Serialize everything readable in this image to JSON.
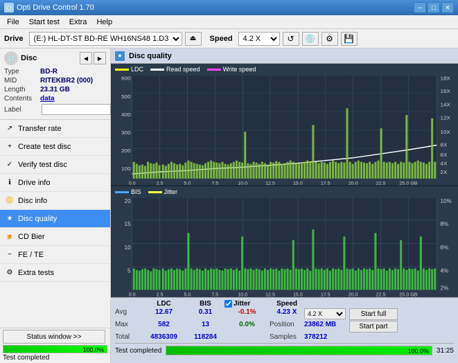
{
  "app": {
    "title": "Opti Drive Control 1.70",
    "icon": "💿"
  },
  "titlebar": {
    "minimize": "─",
    "maximize": "□",
    "close": "✕"
  },
  "menu": {
    "items": [
      "File",
      "Start test",
      "Extra",
      "Help"
    ]
  },
  "drive_bar": {
    "label": "Drive",
    "drive_value": "(E:) HL-DT-ST BD-RE  WH16NS48 1.D3",
    "speed_label": "Speed",
    "speed_value": "4.2 X"
  },
  "disc": {
    "title": "Disc",
    "type_label": "Type",
    "type_value": "BD-R",
    "mid_label": "MID",
    "mid_value": "RITEKBR2 (000)",
    "length_label": "Length",
    "length_value": "23.31 GB",
    "contents_label": "Contents",
    "contents_value": "data",
    "label_label": "Label",
    "label_placeholder": ""
  },
  "nav": {
    "items": [
      {
        "id": "transfer-rate",
        "label": "Transfer rate",
        "icon": "↗"
      },
      {
        "id": "create-test-disc",
        "label": "Create test disc",
        "icon": "+"
      },
      {
        "id": "verify-test-disc",
        "label": "Verify test disc",
        "icon": "✓"
      },
      {
        "id": "drive-info",
        "label": "Drive info",
        "icon": "ℹ"
      },
      {
        "id": "disc-info",
        "label": "Disc info",
        "icon": "📀"
      },
      {
        "id": "disc-quality",
        "label": "Disc quality",
        "icon": "★",
        "active": true
      },
      {
        "id": "cd-bier",
        "label": "CD Bier",
        "icon": "🍺"
      },
      {
        "id": "fe-te",
        "label": "FE / TE",
        "icon": "~"
      },
      {
        "id": "extra-tests",
        "label": "Extra tests",
        "icon": "⚙"
      }
    ]
  },
  "status_bar": {
    "button_label": "Status window >>",
    "progress_percent": "100.0%",
    "progress_value": 100,
    "status_text": "Test completed"
  },
  "chart": {
    "title": "Disc quality",
    "icon": "★",
    "legend1": {
      "ldc_label": "LDC",
      "read_label": "Read speed",
      "write_label": "Write speed"
    },
    "legend2": {
      "bis_label": "BIS",
      "jitter_label": "Jitter"
    },
    "upper_y_axis": [
      "600",
      "500",
      "400",
      "300",
      "200",
      "100"
    ],
    "upper_y_right": [
      "18X",
      "16X",
      "14X",
      "12X",
      "10X",
      "8X",
      "6X",
      "4X",
      "2X"
    ],
    "x_axis": [
      "0.0",
      "2.5",
      "5.0",
      "7.5",
      "10.0",
      "12.5",
      "15.0",
      "17.5",
      "20.0",
      "22.5",
      "25.0 GB"
    ],
    "lower_y_axis": [
      "20",
      "15",
      "10",
      "5"
    ],
    "lower_y_right": [
      "10%",
      "8%",
      "6%",
      "4%",
      "2%"
    ]
  },
  "stats": {
    "col_headers": [
      "",
      "LDC",
      "BIS",
      "",
      "Jitter",
      "Speed",
      ""
    ],
    "avg_label": "Avg",
    "avg_ldc": "12.67",
    "avg_bis": "0.31",
    "avg_jitter": "-0.1%",
    "max_label": "Max",
    "max_ldc": "582",
    "max_bis": "13",
    "max_jitter": "0.0%",
    "total_label": "Total",
    "total_ldc": "4836309",
    "total_bis": "118284",
    "speed_label": "Speed",
    "speed_value": "4.23 X",
    "speed_select": "4.2 X",
    "position_label": "Position",
    "position_value": "23862 MB",
    "samples_label": "Samples",
    "samples_value": "378212",
    "jitter_checked": true,
    "start_full": "Start full",
    "start_part": "Start part"
  },
  "bottom": {
    "status_text": "Test completed",
    "progress_value": 100,
    "progress_text": "100.0%",
    "time": "31:25"
  }
}
